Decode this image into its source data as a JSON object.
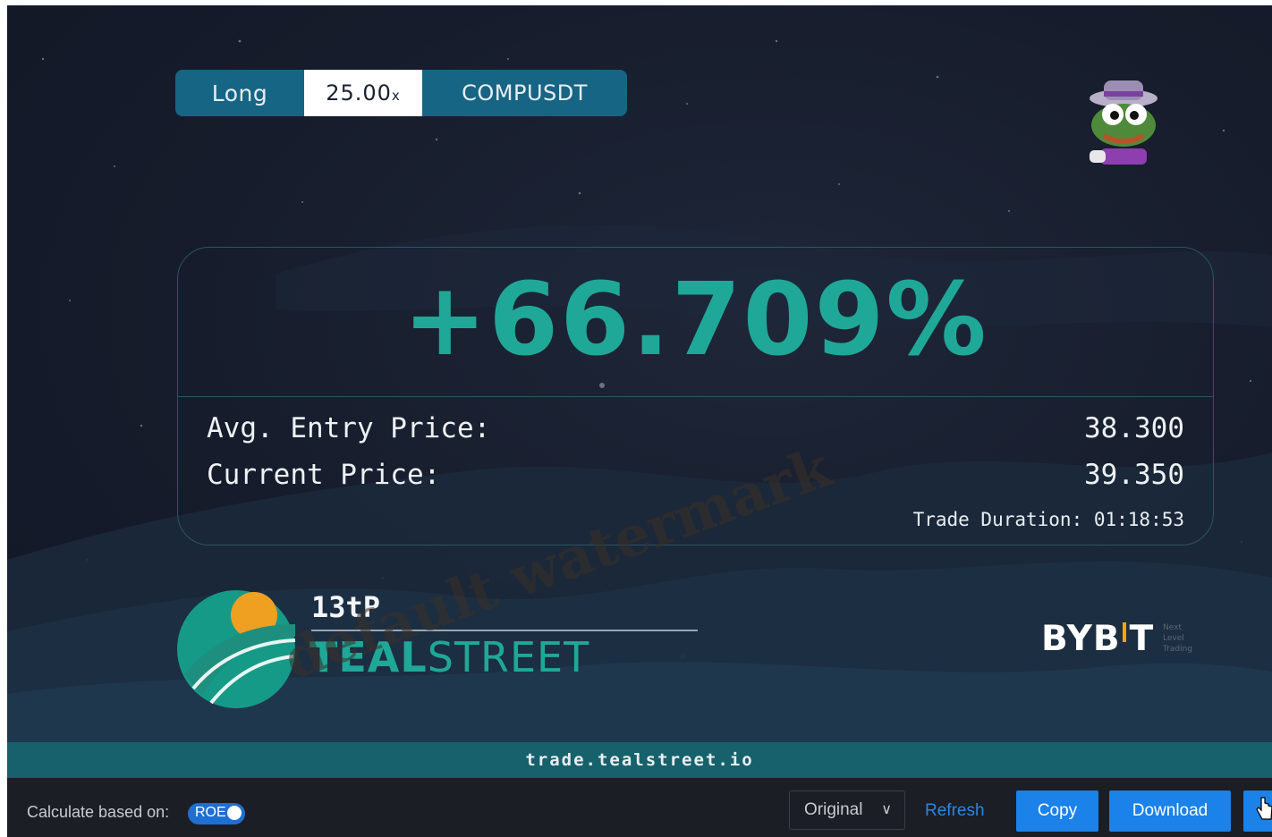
{
  "position": {
    "side": "Long",
    "leverage": "25.00",
    "leverage_suffix": "x",
    "symbol": "COMPUSDT"
  },
  "pnl": {
    "value": "+66.709%",
    "color": "#1fa897"
  },
  "prices": {
    "entry_label": "Avg. Entry Price:",
    "entry_value": "38.300",
    "current_label": "Current Price:",
    "current_value": "39.350"
  },
  "duration": {
    "text": "Trade Duration: 01:18:53"
  },
  "branding": {
    "username": "13tP",
    "brand_bold": "TEAL",
    "brand_light": "STREET",
    "exchange_a": "BYB",
    "exchange_b": "T",
    "exchange_tag": [
      "Next",
      "Level",
      "Trading"
    ],
    "footer_url": "trade.tealstreet.io",
    "avatar_icon": "frog-avatar-icon",
    "logo_icon": "tealstreet-logo-icon"
  },
  "watermark": "default watermark",
  "toolbar": {
    "calc_label": "Calculate based on:",
    "toggle_label": "ROE",
    "toggle_on": true,
    "select_value": "Original",
    "refresh_label": "Refresh",
    "copy_label": "Copy",
    "download_label": "Download"
  },
  "colors": {
    "teal": "#1fa897",
    "pill_bg": "#176584",
    "footer_bg": "#16616b",
    "button_blue": "#1a82e8",
    "link_blue": "#2a86e6",
    "bybit_accent": "#f7a600"
  }
}
